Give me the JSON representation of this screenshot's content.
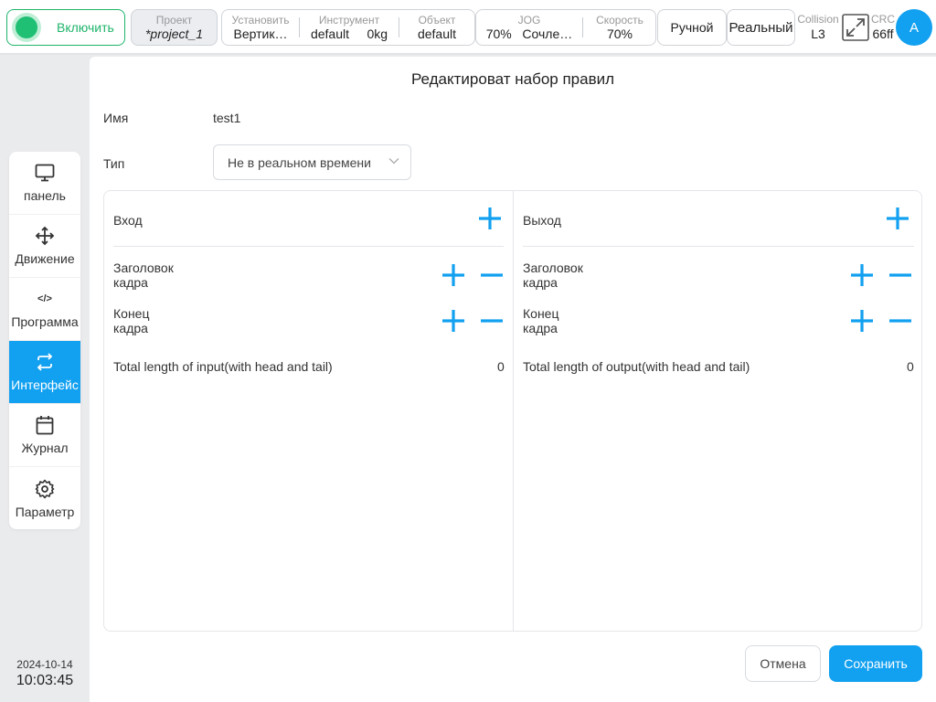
{
  "topbar": {
    "power_label": "Включить",
    "project": {
      "caption": "Проект",
      "value": "*project_1"
    },
    "install": {
      "caption": "Установить",
      "value": "Вертик…"
    },
    "tool": {
      "caption": "Инструмент",
      "value": "default",
      "weight": "0kg"
    },
    "object": {
      "caption": "Объект",
      "value": "default"
    },
    "jog": {
      "caption": "JOG",
      "value": "70%",
      "mode": "Сочле…"
    },
    "speed": {
      "caption": "Скорость",
      "value": "70%"
    },
    "mode_label": "Ручной",
    "real_label": "Реальный",
    "collision": {
      "caption": "Collision",
      "value": "L3"
    },
    "crc": {
      "caption": "CRC",
      "value": "66ff"
    },
    "avatar_letter": "A",
    "icons": {
      "expand": "expand-icon"
    }
  },
  "nav": {
    "items": [
      {
        "label": "панель",
        "icon": "monitor-icon"
      },
      {
        "label": "Движение",
        "icon": "move-icon"
      },
      {
        "label": "Программа",
        "icon": "code-icon"
      },
      {
        "label": "Интерфейс",
        "icon": "swap-icon",
        "active": true
      },
      {
        "label": "Журнал",
        "icon": "calendar-icon"
      },
      {
        "label": "Параметр",
        "icon": "gear-icon"
      }
    ],
    "code_glyph": "</>"
  },
  "datetime": {
    "date": "2024-10-14",
    "time": "10:03:45"
  },
  "dialog": {
    "title": "Редактироват набор правил",
    "name_label": "Имя",
    "name_value": "test1",
    "type_label": "Тип",
    "type_value": "Не в реальном времени",
    "input": {
      "title": "Вход",
      "header_label": "Заголовок кадра",
      "end_label": "Конец кадра",
      "total_label": "Total length of input(with head and tail)",
      "total_value": "0"
    },
    "output": {
      "title": "Выход",
      "header_label": "Заголовок кадра",
      "end_label": "Конец кадра",
      "total_label": "Total length of output(with head and tail)",
      "total_value": "0"
    },
    "cancel_label": "Отмена",
    "save_label": "Сохранить"
  },
  "colors": {
    "accent": "#12a0f0",
    "power_green": "#1fbf74"
  }
}
